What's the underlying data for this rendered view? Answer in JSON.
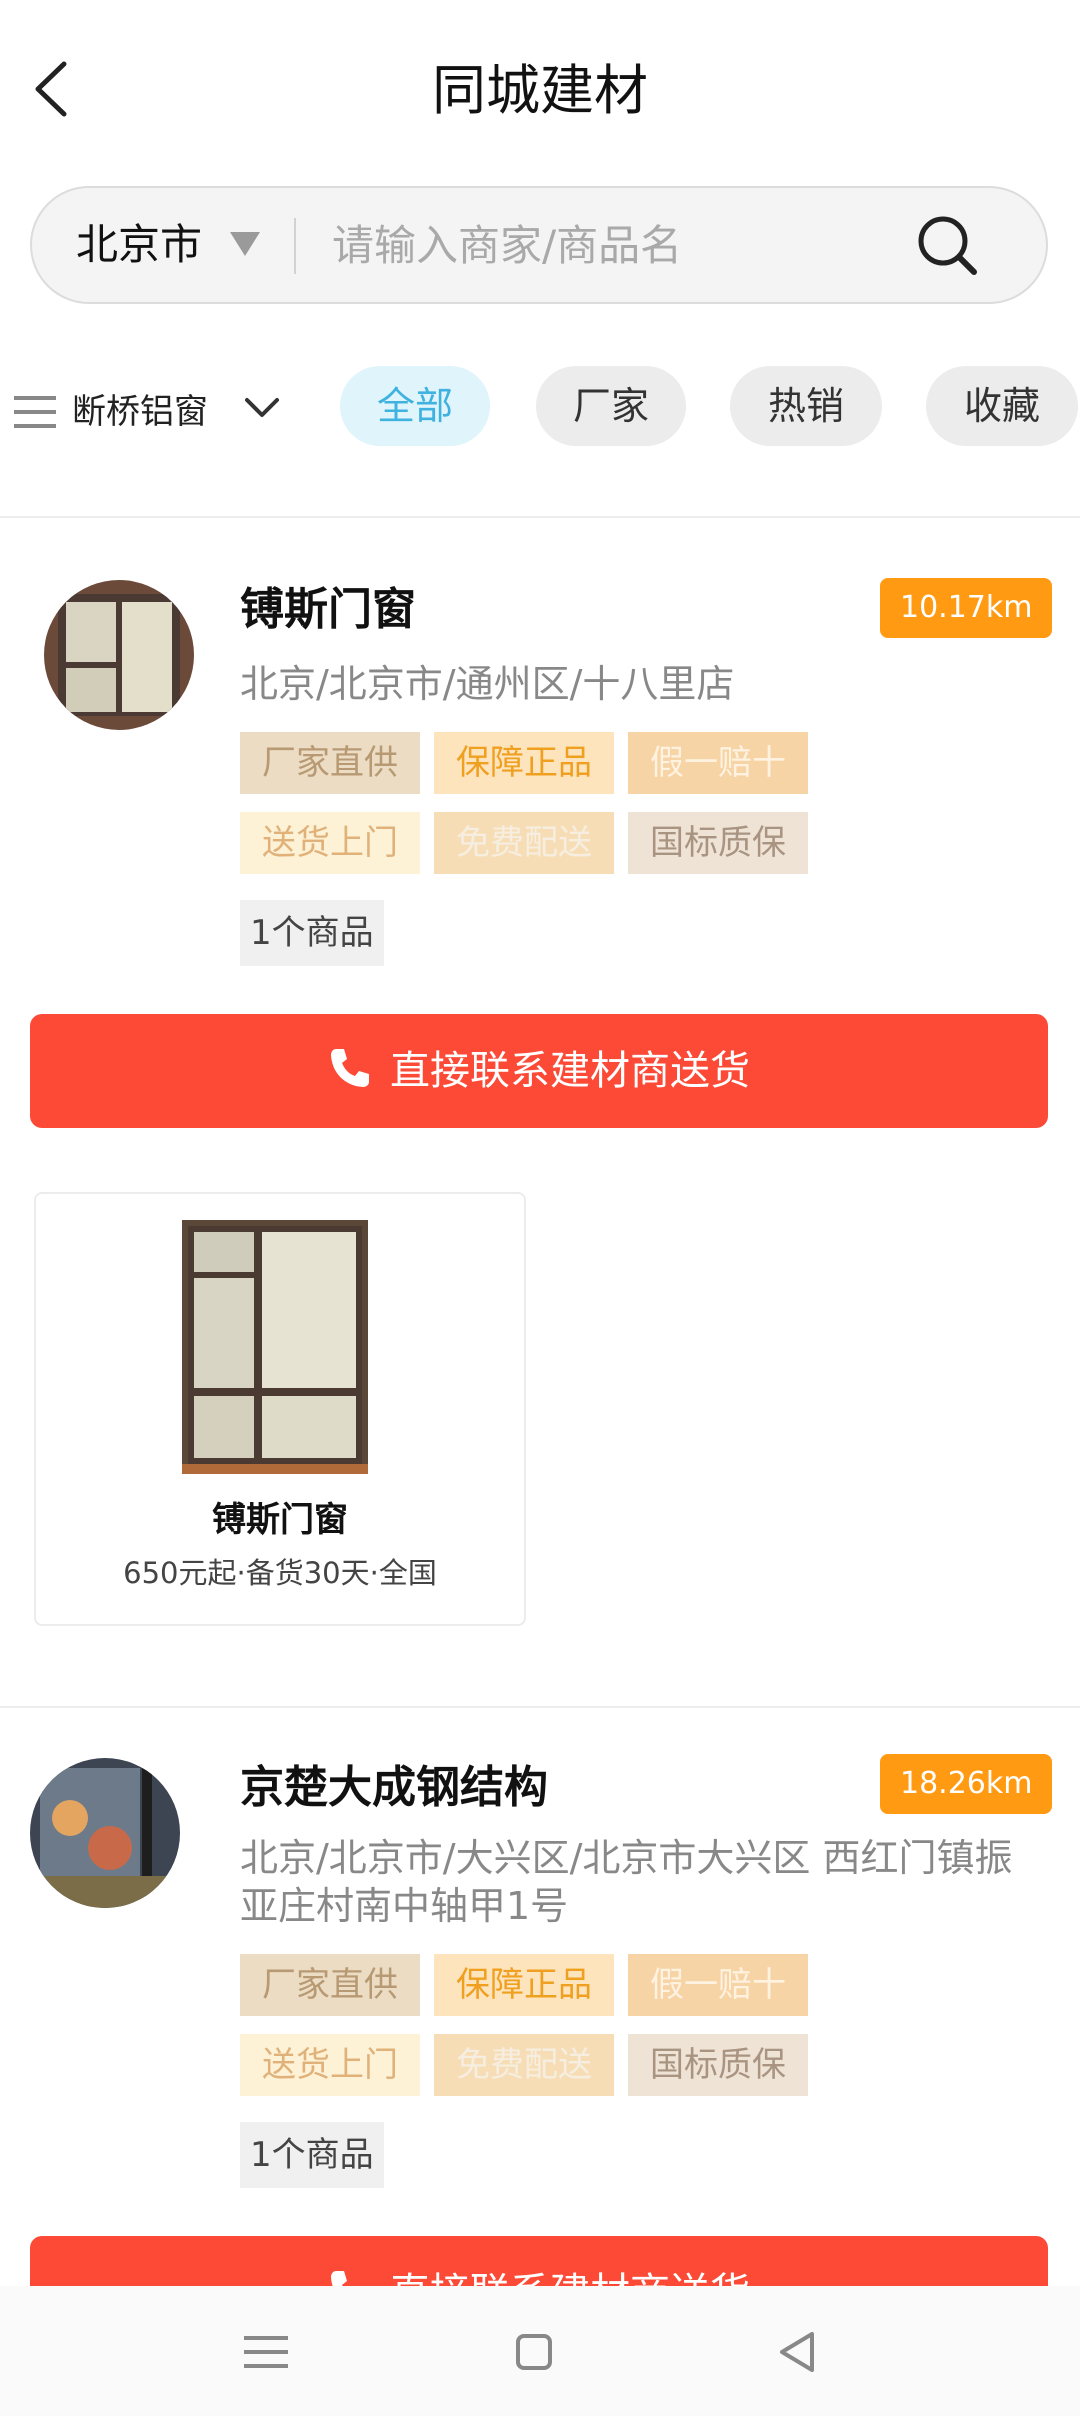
{
  "header": {
    "title": "同城建材",
    "back_icon": "back-arrow-icon"
  },
  "search": {
    "city": "北京市",
    "placeholder": "请输入商家/商品名",
    "icon": "search-icon"
  },
  "filters": {
    "category": "断桥铝窗",
    "chips": [
      {
        "label": "全部",
        "active": true
      },
      {
        "label": "厂家",
        "active": false
      },
      {
        "label": "热销",
        "active": false
      },
      {
        "label": "收藏",
        "active": false
      }
    ]
  },
  "stores": [
    {
      "name": "镈斯门窗",
      "distance": "10.17km",
      "address": "北京/北京市/通州区/十八里店",
      "tags": [
        "厂家直供",
        "保障正品",
        "假一赔十",
        "送货上门",
        "免费配送",
        "国标质保"
      ],
      "product_count": "1个商品",
      "cta": "直接联系建材商送货",
      "products": [
        {
          "name": "镈斯门窗",
          "meta": "650元起·备货30天·全国"
        }
      ]
    },
    {
      "name": "京楚大成钢结构",
      "distance": "18.26km",
      "address": "北京/北京市/大兴区/北京市大兴区 西红门镇振亚庄村南中轴甲1号",
      "tags": [
        "厂家直供",
        "保障正品",
        "假一赔十",
        "送货上门",
        "免费配送",
        "国标质保"
      ],
      "product_count": "1个商品",
      "cta": "直接联系建材商送货"
    }
  ],
  "colors": {
    "accent": "#fc4a36",
    "distance_badge": "#ff9a12",
    "chip_active_bg": "#dff4fb",
    "chip_active_text": "#3fb2df"
  },
  "navbar": {
    "icons": [
      "menu-icon",
      "home-square-icon",
      "back-triangle-icon"
    ]
  }
}
